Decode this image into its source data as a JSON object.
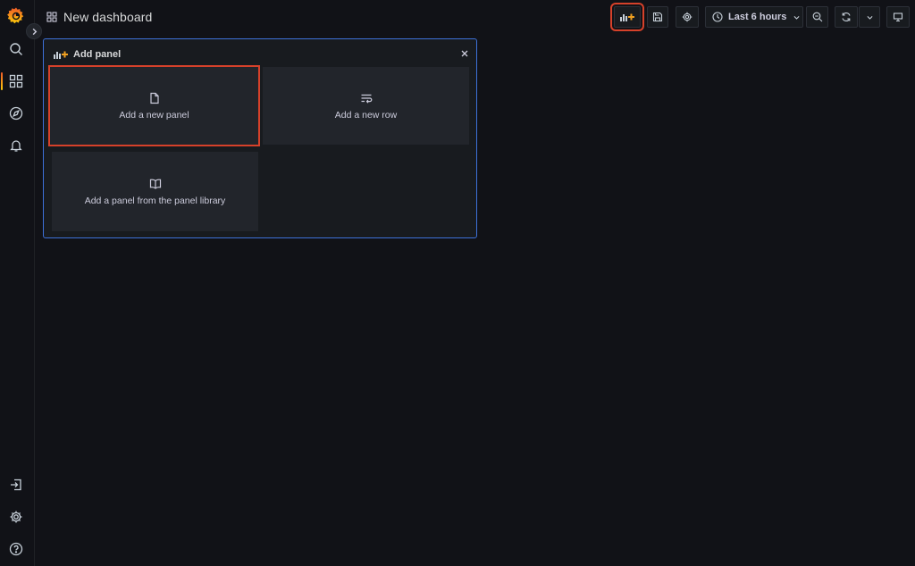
{
  "sidebar": {
    "logo": "grafana-logo",
    "items": [
      {
        "name": "search",
        "icon": "search-icon"
      },
      {
        "name": "dashboards",
        "icon": "dashboards-grid-icon",
        "active": true
      },
      {
        "name": "explore",
        "icon": "compass-icon"
      },
      {
        "name": "alerting",
        "icon": "bell-icon"
      }
    ],
    "bottom_items": [
      {
        "name": "sign-in",
        "icon": "sign-in-icon"
      },
      {
        "name": "configuration",
        "icon": "gear-icon"
      },
      {
        "name": "help",
        "icon": "help-icon"
      }
    ]
  },
  "header": {
    "title": "New dashboard",
    "time_range": "Last 6 hours"
  },
  "toolbar": {
    "add_panel": "add-panel-icon",
    "save": "save-icon",
    "settings": "gear-icon",
    "zoom_out": "zoom-out-icon",
    "refresh": "refresh-icon",
    "refresh_interval": "chevron-down-icon",
    "view_mode": "monitor-icon"
  },
  "add_panel": {
    "title": "Add panel",
    "options": [
      {
        "label": "Add a new panel",
        "icon": "file-blank-icon"
      },
      {
        "label": "Add a new row",
        "icon": "wrap-text-icon"
      },
      {
        "label": "Add a panel from the panel library",
        "icon": "book-open-icon"
      }
    ]
  },
  "colors": {
    "background": "#111217",
    "panel": "#181b1f",
    "option": "#22252b",
    "accent_border": "#3d71d9",
    "highlight": "#d6412a",
    "logo_orange": "#f05a28",
    "logo_yellow": "#fbca0a"
  }
}
